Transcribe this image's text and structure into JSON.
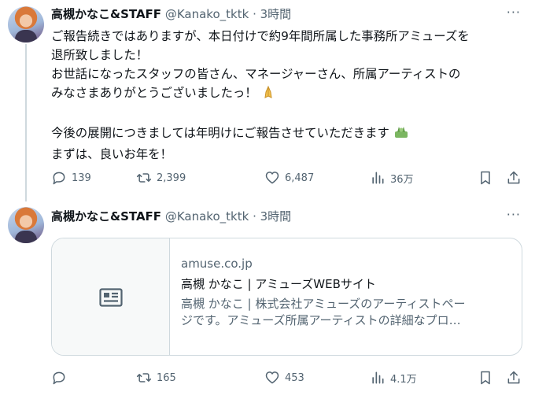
{
  "tweets": [
    {
      "author_name": "高槻かなこ&STAFF",
      "handle": "@Kanako_tktk",
      "separator": "·",
      "time": "3時間",
      "lines": [
        "ご報告続きではありますが、本日付けで約9年間所属した事務所アミューズを",
        "退所致しました！",
        "お世話になったスタッフの皆さん、マネージャーさん、所属アーティストの",
        "みなさまありがとうございましたっ！",
        "",
        "今後の展開につきましては年明けにご報告させていただきます",
        "まずは、良いお年を！"
      ],
      "emojis": [
        "folded-hands",
        "folded-hands-small"
      ],
      "replies": "139",
      "retweets": "2,399",
      "likes": "6,487",
      "views": "36万"
    },
    {
      "author_name": "高槻かなこ&STAFF",
      "handle": "@Kanako_tktk",
      "separator": "·",
      "time": "3時間",
      "card": {
        "domain": "amuse.co.jp",
        "title": "高槻 かなこ | アミューズWEBサイト",
        "desc_line1": "高槻 かなこ | 株式会社アミューズのアーティストペー",
        "desc_line2": "ジです。アミューズ所属アーティストの詳細なプロ…"
      },
      "replies": "",
      "retweets": "165",
      "likes": "453",
      "views": "4.1万"
    }
  ],
  "more_label": "···"
}
